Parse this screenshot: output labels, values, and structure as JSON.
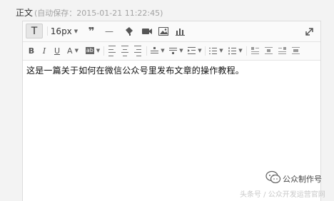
{
  "header": {
    "label": "正文",
    "autosave": "(自动保存：2015-01-21 11:22:45)"
  },
  "toolbar": {
    "text_format_glyph": "T",
    "font_size": "16px",
    "quote_glyph": "❞",
    "hr_glyph": "—",
    "bold_glyph": "B",
    "italic_glyph": "I",
    "underline_glyph": "U",
    "font_color_glyph": "A",
    "highlight_glyph": "ab"
  },
  "content": {
    "text": "这是一篇关于如何在微信公众号里发布文章的操作教程。"
  },
  "watermark": {
    "account_name": "公众制作号",
    "source": "头条号 / 公众开发运营官网"
  }
}
